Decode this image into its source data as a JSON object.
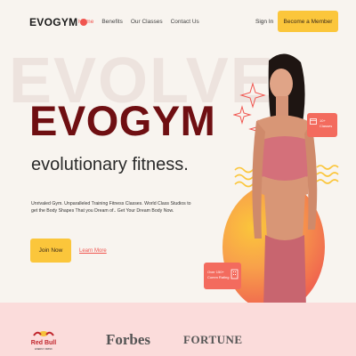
{
  "brand": {
    "logo_text": "EVOGYM"
  },
  "nav": {
    "links": [
      "Home",
      "Benefits",
      "Our Classes",
      "Contact Us"
    ],
    "active_index": 0,
    "sign_in": "Sign In",
    "cta": "Become a Member"
  },
  "hero": {
    "background_word": "EVOLVE",
    "title": "EVOGYM",
    "tagline": "evolutionary fitness.",
    "description": "Unrivaled Gym. Unparalleled Training Fitness Classes. World Class Studios to get the Body Shapes That you Dream of.. Get Your Dream Body Now.",
    "join_button": "Join Now",
    "learn_more": "Learn More"
  },
  "badges": {
    "classes": {
      "line1": "10+",
      "line2": "Classes"
    },
    "rating": {
      "line1": "Over 150+",
      "line2": "Comm Rating"
    }
  },
  "sponsors": {
    "redbull": "Red Bull",
    "forbes": "Forbes",
    "fortune": "FORTUNE"
  },
  "colors": {
    "accent": "#f0554f",
    "cta": "#fbc63b",
    "brand_red": "#6f0f12",
    "sponsor_bg": "#fbdcdb"
  }
}
